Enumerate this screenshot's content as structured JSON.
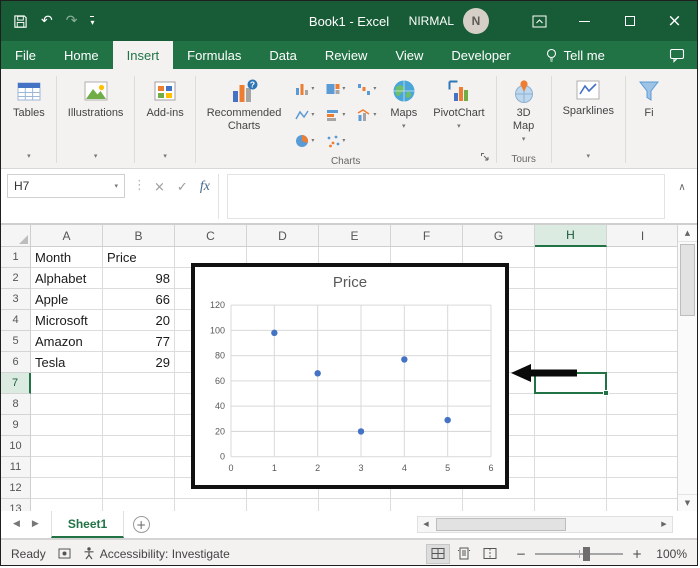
{
  "titlebar": {
    "title": "Book1 - Excel",
    "user_name": "NIRMAL",
    "avatar_initial": "N"
  },
  "ribbon_tabs": {
    "items": [
      "File",
      "Home",
      "Insert",
      "Formulas",
      "Data",
      "Review",
      "View",
      "Developer"
    ],
    "active": "Insert",
    "tell_me": "Tell me"
  },
  "ribbon": {
    "tables": "Tables",
    "illustrations": "Illustrations",
    "addins": "Add-ins",
    "recommended_charts": "Recommended\nCharts",
    "charts_group": "Charts",
    "maps": "Maps",
    "pivotchart": "PivotChart",
    "map_3d": "3D Map",
    "tours_group": "Tours",
    "sparklines": "Sparklines",
    "filters_partial": "Fi"
  },
  "formula_bar": {
    "name_box": "H7",
    "fx": "fx",
    "value": ""
  },
  "grid": {
    "columns": [
      "A",
      "B",
      "C",
      "D",
      "E",
      "F",
      "G",
      "H",
      "I"
    ],
    "row_count": 13,
    "selected": {
      "cell": "H7",
      "column": "H",
      "row": 7
    },
    "data": {
      "A1": "Month",
      "B1": "Price",
      "A2": "Alphabet",
      "B2": "98",
      "A3": "Apple",
      "B3": "66",
      "A4": "Microsoft",
      "B4": "20",
      "A5": "Amazon",
      "B5": "77",
      "A6": "Tesla",
      "B6": "29"
    }
  },
  "chart_data": {
    "type": "scatter",
    "title": "Price",
    "series": [
      {
        "name": "Price",
        "x": [
          1,
          2,
          3,
          4,
          5
        ],
        "y": [
          98,
          66,
          20,
          77,
          29
        ]
      }
    ],
    "xlim": [
      0,
      6
    ],
    "ylim": [
      0,
      120
    ],
    "xticks": [
      0,
      1,
      2,
      3,
      4,
      5,
      6
    ],
    "yticks": [
      0,
      20,
      40,
      60,
      80,
      100,
      120
    ],
    "grid": true,
    "legend": false,
    "point_color": "#4472c4",
    "title_color": "#595959"
  },
  "sheet_bar": {
    "active_tab": "Sheet1"
  },
  "status_bar": {
    "mode": "Ready",
    "accessibility": "Accessibility: Investigate",
    "zoom_level": "100%"
  },
  "icons": {
    "dropdown": "▾",
    "undo": "↶",
    "redo": "↷",
    "vertical_dots": "⋮",
    "cancel": "×",
    "enter": "✓",
    "expand_formula_bar": "∧",
    "prev": "◀",
    "next": "▶",
    "up": "▲",
    "down": "▼",
    "zoom_out": "−",
    "zoom_in": "+",
    "add": "+"
  },
  "colors": {
    "accent": "#217346",
    "titlebar": "#185c37",
    "selection": "#217346",
    "chart_point": "#4472c4"
  }
}
